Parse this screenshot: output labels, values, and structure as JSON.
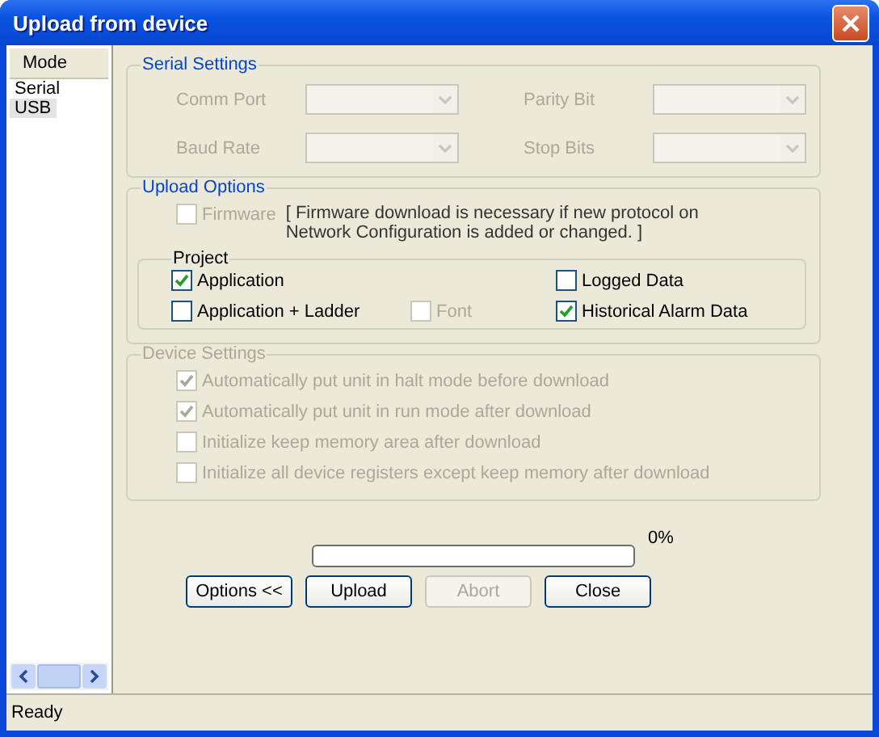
{
  "window": {
    "title": "Upload from device"
  },
  "mode_list": {
    "header": "Mode",
    "items": [
      {
        "label": "Serial",
        "selected": false
      },
      {
        "label": "USB",
        "selected": true
      }
    ]
  },
  "serial_settings": {
    "title": "Serial Settings",
    "disabled": true,
    "fields": [
      {
        "label": "Comm Port"
      },
      {
        "label": "Parity Bit"
      },
      {
        "label": "Baud Rate"
      },
      {
        "label": "Stop Bits"
      }
    ]
  },
  "upload_options": {
    "title": "Upload Options",
    "firmware": {
      "label": "Firmware",
      "checked": false,
      "disabled": true
    },
    "firmware_note": "[ Firmware download is necessary if new protocol on Network Configuration is added or changed. ]",
    "project": {
      "title": "Project",
      "items": [
        {
          "label": "Application",
          "checked": true,
          "disabled": false
        },
        {
          "label": "Logged Data",
          "checked": false,
          "disabled": false
        },
        {
          "label": "Application + Ladder",
          "checked": false,
          "disabled": false
        },
        {
          "label": "Font",
          "checked": false,
          "disabled": true
        },
        {
          "label": "Historical Alarm Data",
          "checked": true,
          "disabled": false
        }
      ]
    }
  },
  "device_settings": {
    "title": "Device Settings",
    "disabled": true,
    "items": [
      {
        "label": "Automatically put unit in halt mode before download",
        "checked": true
      },
      {
        "label": "Automatically put unit in run mode after download",
        "checked": true
      },
      {
        "label": "Initialize keep memory area after download",
        "checked": false
      },
      {
        "label": "Initialize all device registers except keep memory after download",
        "checked": false
      }
    ]
  },
  "progress": {
    "level": 0,
    "reading": "0%"
  },
  "buttons": [
    {
      "label": "Options <<",
      "disabled": false
    },
    {
      "label": "Upload",
      "disabled": false
    },
    {
      "label": "Abort",
      "disabled": true
    },
    {
      "label": "Close",
      "disabled": false
    }
  ],
  "status_bar": {
    "text": "Ready"
  }
}
